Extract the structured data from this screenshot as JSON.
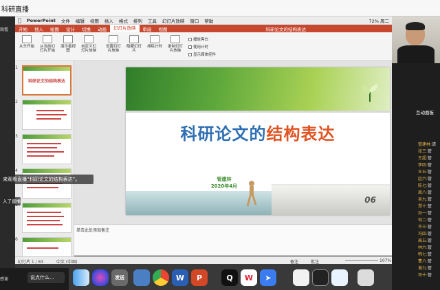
{
  "outer_window": {
    "title": "科研直播"
  },
  "mac_menubar": {
    "items": [
      "PowerPoint",
      "文件",
      "编辑",
      "视图",
      "插入",
      "格式",
      "排列",
      "工具",
      "幻灯片放映",
      "窗口",
      "帮助"
    ],
    "doc_title": "科研论文的结构表达",
    "right_status": "72% 周二"
  },
  "ribbon": {
    "tabs": [
      "开始",
      "插入",
      "绘图",
      "设计",
      "切换",
      "动画",
      "幻灯片放映",
      "审阅",
      "视图"
    ],
    "active_tab": "幻灯片放映",
    "buttons": [
      "从头开始",
      "从当前幻灯片开始",
      "演示者视图",
      "自定义幻灯片放映",
      "设置幻灯片放映",
      "隐藏幻灯片",
      "排练计时",
      "录制幻灯片放映"
    ],
    "checkboxes": [
      "播放旁白",
      "使用计时",
      "显示媒体控件"
    ]
  },
  "thumbnails": [
    {
      "num": "1",
      "title": "科研论文的结构表达"
    },
    {
      "num": "2",
      "title": ""
    },
    {
      "num": "3",
      "title": ""
    },
    {
      "num": "4",
      "title": ""
    },
    {
      "num": "5",
      "title": ""
    },
    {
      "num": "6",
      "title": ""
    }
  ],
  "slide": {
    "title_part1": "科研论文的",
    "title_part2": "结构表达",
    "author": "管建林",
    "date": "2020年4月",
    "book_number": "06"
  },
  "notes": {
    "placeholder": "单击此处添加备注"
  },
  "statusbar": {
    "slide_count": "幻灯片 1 / 83",
    "language": "中文 (中国)",
    "notes_btn": "备注",
    "comments_btn": "批注",
    "zoom": "107%"
  },
  "overlays": {
    "live_hint": "来观看直播“科研论文的结构表达”。",
    "enter_hint": "入了直播",
    "left_caption": "观看"
  },
  "bottom_left": {
    "label": "感谢",
    "comment_input": "说点什么..."
  },
  "dock": {
    "apps": [
      "Finder",
      "Siri",
      "发送",
      "预览",
      "Chrome",
      "Word",
      "PowerPoint",
      "QQ",
      "WPS",
      "Feishu",
      "文本",
      "图片",
      "下载",
      "废纸篓"
    ]
  },
  "chat": {
    "header": "互动面板",
    "messages": [
      {
        "name": "管建林:",
        "text": "请"
      },
      {
        "name": "张三:",
        "text": "管"
      },
      {
        "name": "王超:",
        "text": "管"
      },
      {
        "name": "李四:",
        "text": "管"
      },
      {
        "name": "王五:",
        "text": "管"
      },
      {
        "name": "赵六:",
        "text": "管"
      },
      {
        "name": "陈七:",
        "text": "管"
      },
      {
        "name": "周八:",
        "text": "管"
      },
      {
        "name": "吴九:",
        "text": "管"
      },
      {
        "name": "郑十:",
        "text": "管"
      },
      {
        "name": "孙一:",
        "text": "管"
      },
      {
        "name": "何二:",
        "text": "管"
      },
      {
        "name": "许三:",
        "text": "管"
      },
      {
        "name": "冯四:",
        "text": "管"
      },
      {
        "name": "高五:",
        "text": "管"
      },
      {
        "name": "林六:",
        "text": "管"
      },
      {
        "name": "韩七:",
        "text": "管"
      },
      {
        "name": "曹八:",
        "text": "管"
      },
      {
        "name": "谢九:",
        "text": "管"
      },
      {
        "name": "邓十:",
        "text": "管"
      }
    ]
  },
  "colors": {
    "accent": "#c8472f",
    "title_blue": "#2f6fb3",
    "title_red": "#e05423",
    "green": "#3d8b2b"
  }
}
